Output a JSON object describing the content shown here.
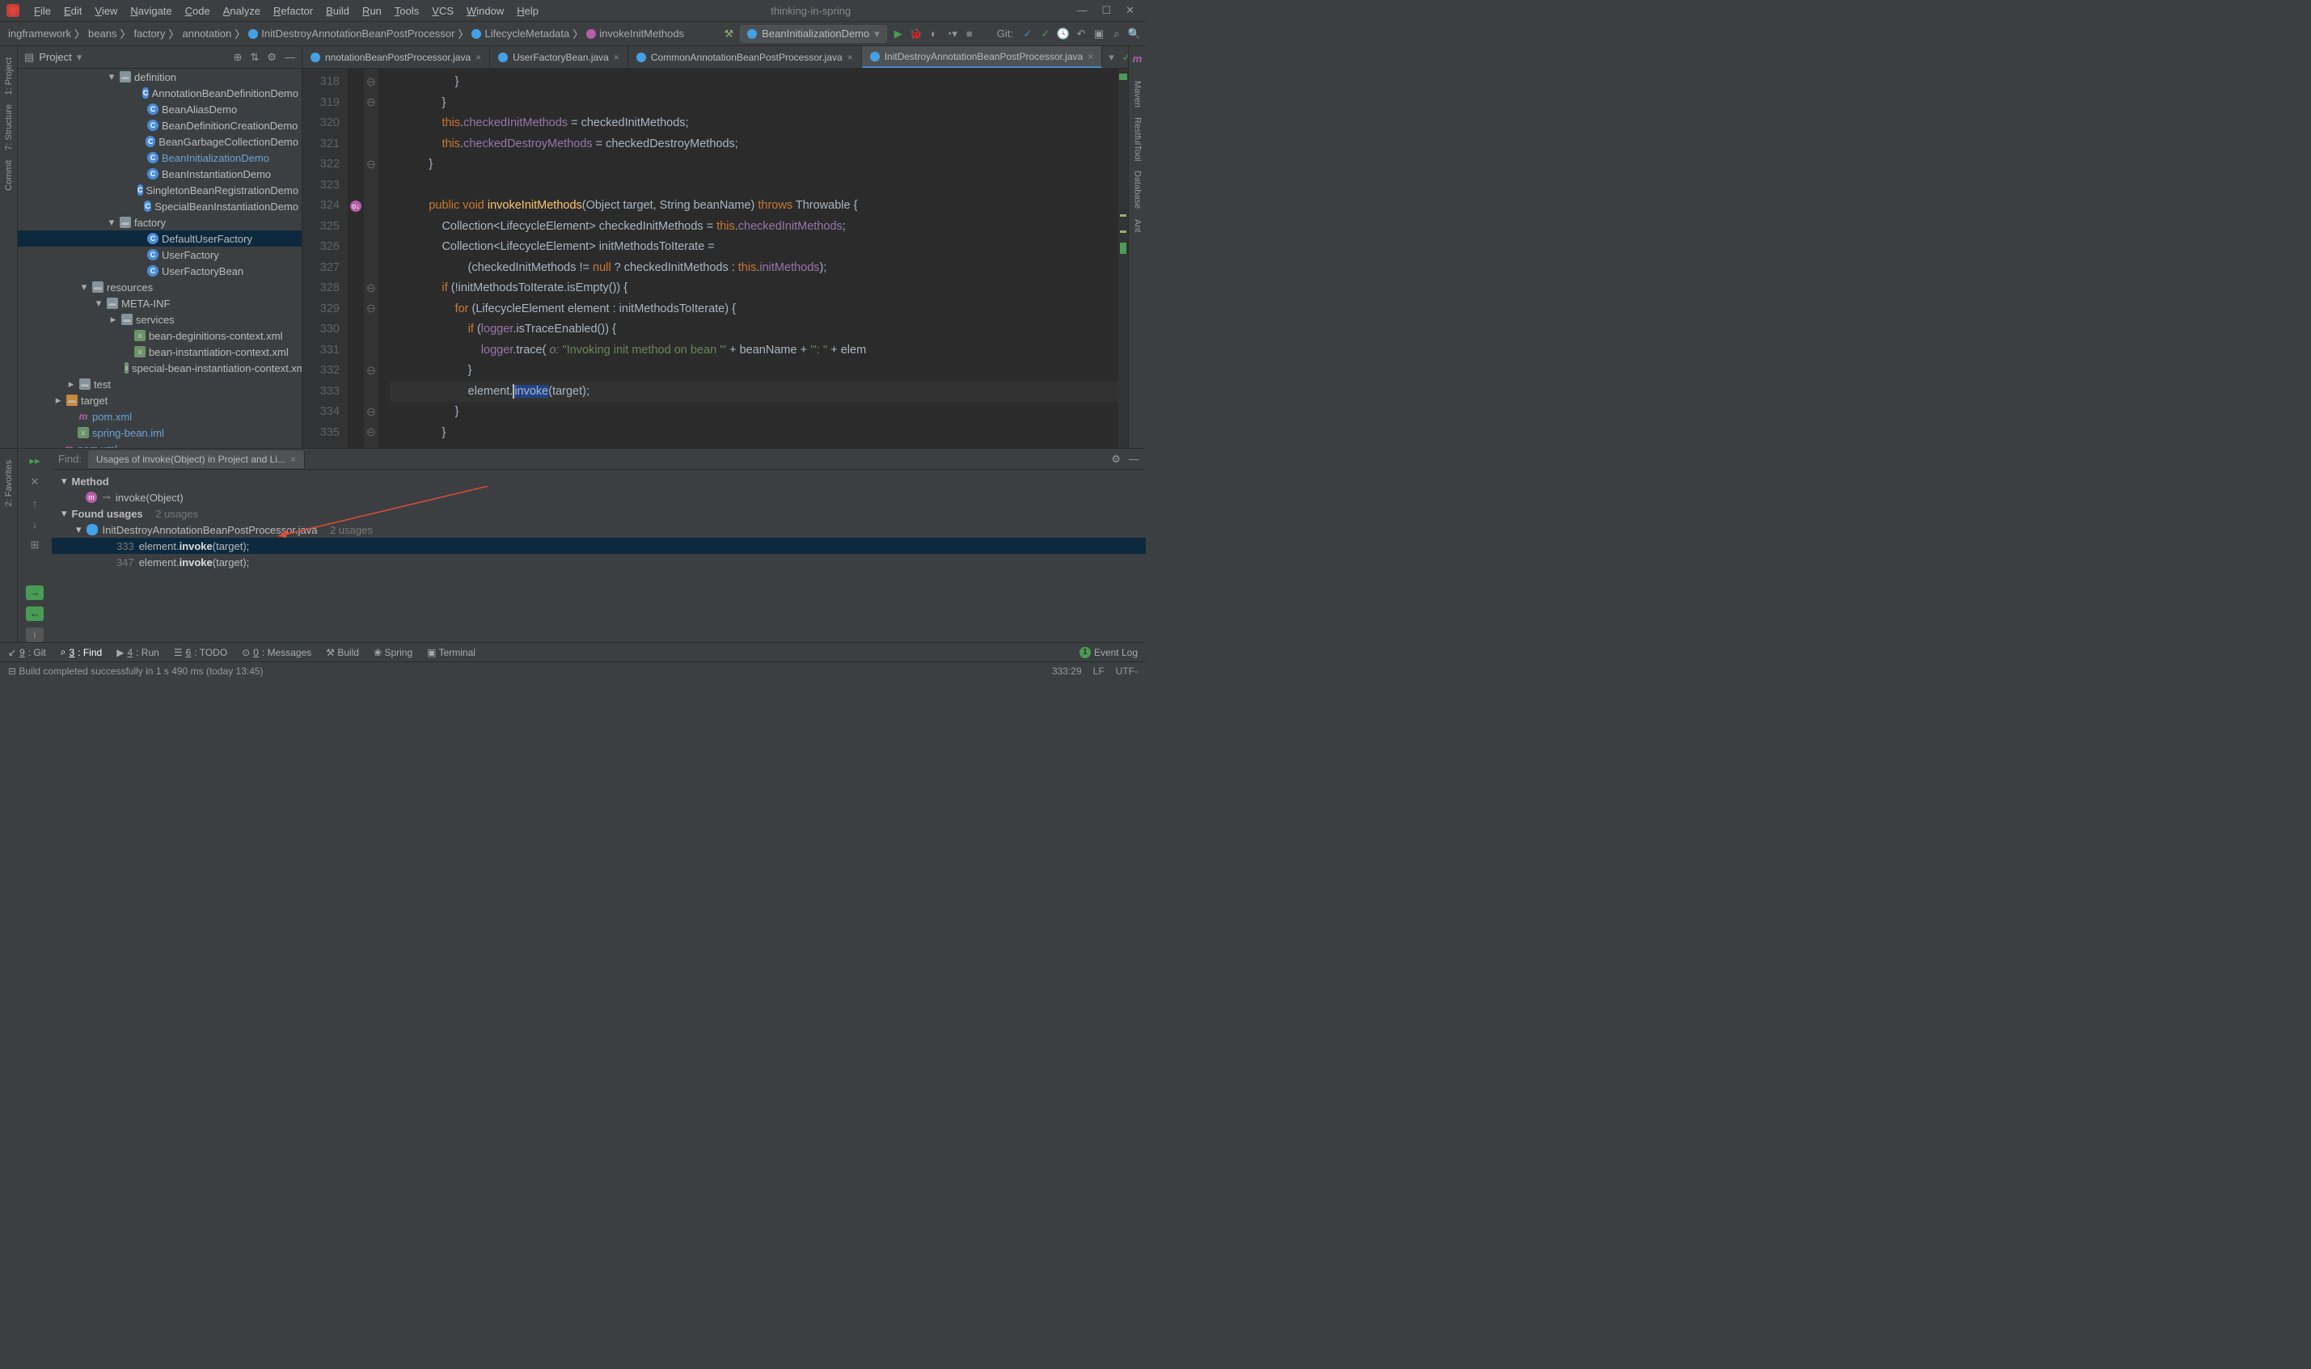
{
  "project_title": "thinking-in-spring",
  "menu": [
    "File",
    "Edit",
    "View",
    "Navigate",
    "Code",
    "Analyze",
    "Refactor",
    "Build",
    "Run",
    "Tools",
    "VCS",
    "Window",
    "Help"
  ],
  "breadcrumbs": [
    {
      "t": "ingframework"
    },
    {
      "t": "beans"
    },
    {
      "t": "factory"
    },
    {
      "t": "annotation"
    },
    {
      "t": "InitDestroyAnnotationBeanPostProcessor",
      "i": "c"
    },
    {
      "t": "LifecycleMetadata",
      "i": "c"
    },
    {
      "t": "invokeInitMethods",
      "i": "m"
    }
  ],
  "run_config": "BeanInitializationDemo",
  "git_label": "Git:",
  "project_panel_title": "Project",
  "tree": [
    {
      "ind": 110,
      "arw": "▾",
      "icon": "fold",
      "lbl": "definition",
      "dim": true
    },
    {
      "ind": 144,
      "icon": "cls",
      "lbl": "AnnotationBeanDefinitionDemo"
    },
    {
      "ind": 144,
      "icon": "cls",
      "lbl": "BeanAliasDemo"
    },
    {
      "ind": 144,
      "icon": "cls",
      "lbl": "BeanDefinitionCreationDemo"
    },
    {
      "ind": 144,
      "icon": "cls",
      "lbl": "BeanGarbageCollectionDemo"
    },
    {
      "ind": 144,
      "icon": "cls",
      "lbl": "BeanInitializationDemo",
      "hl": true
    },
    {
      "ind": 144,
      "icon": "cls",
      "lbl": "BeanInstantiationDemo"
    },
    {
      "ind": 144,
      "icon": "cls",
      "lbl": "SingletonBeanRegistrationDemo"
    },
    {
      "ind": 144,
      "icon": "cls",
      "lbl": "SpecialBeanInstantiationDemo"
    },
    {
      "ind": 110,
      "arw": "▾",
      "icon": "fold",
      "lbl": "factory"
    },
    {
      "ind": 144,
      "icon": "cls",
      "lbl": "DefaultUserFactory",
      "sel": true
    },
    {
      "ind": 144,
      "icon": "cls",
      "lbl": "UserFactory"
    },
    {
      "ind": 144,
      "icon": "cls",
      "lbl": "UserFactoryBean"
    },
    {
      "ind": 76,
      "arw": "▾",
      "icon": "fold",
      "lbl": "resources"
    },
    {
      "ind": 94,
      "arw": "▾",
      "icon": "fold",
      "lbl": "META-INF"
    },
    {
      "ind": 112,
      "arw": "▸",
      "icon": "fold",
      "lbl": "services"
    },
    {
      "ind": 128,
      "icon": "xml",
      "lbl": "bean-deginitions-context.xml"
    },
    {
      "ind": 128,
      "icon": "xml",
      "lbl": "bean-instantiation-context.xml"
    },
    {
      "ind": 128,
      "icon": "xml",
      "lbl": "special-bean-instantiation-context.xml"
    },
    {
      "ind": 60,
      "arw": "▸",
      "icon": "fold",
      "lbl": "test"
    },
    {
      "ind": 44,
      "arw": "▸",
      "icon": "fold-o",
      "lbl": "target"
    },
    {
      "ind": 58,
      "icon": "m",
      "lbl": "pom.xml",
      "hl": true
    },
    {
      "ind": 58,
      "icon": "xml",
      "lbl": "spring-bean.iml",
      "hl": true
    },
    {
      "ind": 40,
      "icon": "m",
      "lbl": "pom.xml",
      "hl": true
    }
  ],
  "tabs": [
    {
      "t": "nnotationBeanPostProcessor.java"
    },
    {
      "t": "UserFactoryBean.java"
    },
    {
      "t": "CommonAnnotationBeanPostProcessor.java"
    },
    {
      "t": "InitDestroyAnnotationBeanPostProcessor.java",
      "active": true
    }
  ],
  "gutter_start": 318,
  "gutter_end": 335,
  "code_lines": [
    "                    }",
    "                }",
    "                <span class='kw'>this</span>.<span class='fld'>checkedInitMethods</span> = checkedInitMethods;",
    "                <span class='kw'>this</span>.<span class='fld'>checkedDestroyMethods</span> = checkedDestroyMethods;",
    "            }",
    "",
    "            <span class='kw'>public void</span> <span class='mth'>invokeInitMethods</span>(Object target, String beanName) <span class='kw'>throws</span> Throwable {",
    "                Collection&lt;LifecycleElement&gt; checkedInitMethods = <span class='kw'>this</span>.<span class='fld'>checkedInitMethods</span>;",
    "                Collection&lt;LifecycleElement&gt; initMethodsToIterate =",
    "                        (checkedInitMethods != <span class='kw'>null</span> ? checkedInitMethods : <span class='kw'>this</span>.<span class='fld'>initMethods</span>);",
    "                <span class='kw'>if</span> (!initMethodsToIterate.isEmpty()) {",
    "                    <span class='kw'>for</span> (LifecycleElement element : initMethodsToIterate) {",
    "                        <span class='kw'>if</span> (<span class='fld'>logger</span>.isTraceEnabled()) {",
    "                            <span class='fld'>logger</span>.trace( <span class='cmt'>o:</span> <span class='str'>\"Invoking init method on bean '\"</span> + beanName + <span class='str'>\"': \"</span> + elem",
    "                        }",
    "                        element.<span class='caret'></span><span style='background:#214283'>invoke</span>(target);",
    "                    }",
    "                }"
  ],
  "find": {
    "label": "Find:",
    "tab": "Usages of invoke(Object) in Project and Li...",
    "method_hdr": "Method",
    "method": "invoke(Object)",
    "found_hdr": "Found usages",
    "found_cnt": "2 usages",
    "file": "InitDestroyAnnotationBeanPostProcessor.java",
    "file_cnt": "2 usages",
    "rows": [
      {
        "n": "333",
        "t": "element.invoke(target);",
        "sel": true
      },
      {
        "n": "347",
        "t": "element.invoke(target);"
      }
    ]
  },
  "bottom": [
    {
      "k": "9",
      "t": "Git"
    },
    {
      "k": "3",
      "t": "Find",
      "act": true
    },
    {
      "k": "4",
      "t": "Run"
    },
    {
      "k": "6",
      "t": "TODO"
    },
    {
      "k": "0",
      "t": "Messages"
    },
    {
      "t": "Build"
    },
    {
      "t": "Spring"
    },
    {
      "t": "Terminal"
    }
  ],
  "event_log": "Event Log",
  "status_msg": "Build completed successfully in 1 s 490 ms (today 13:45)",
  "status_pos": "333:29",
  "status_lf": "LF",
  "status_enc": "UTF-",
  "left_tools": [
    "1: Project",
    "7: Structure",
    "Commit",
    "2: Favorites"
  ],
  "right_tools": [
    "Maven",
    "RestfulTool",
    "Database",
    "Ant"
  ]
}
